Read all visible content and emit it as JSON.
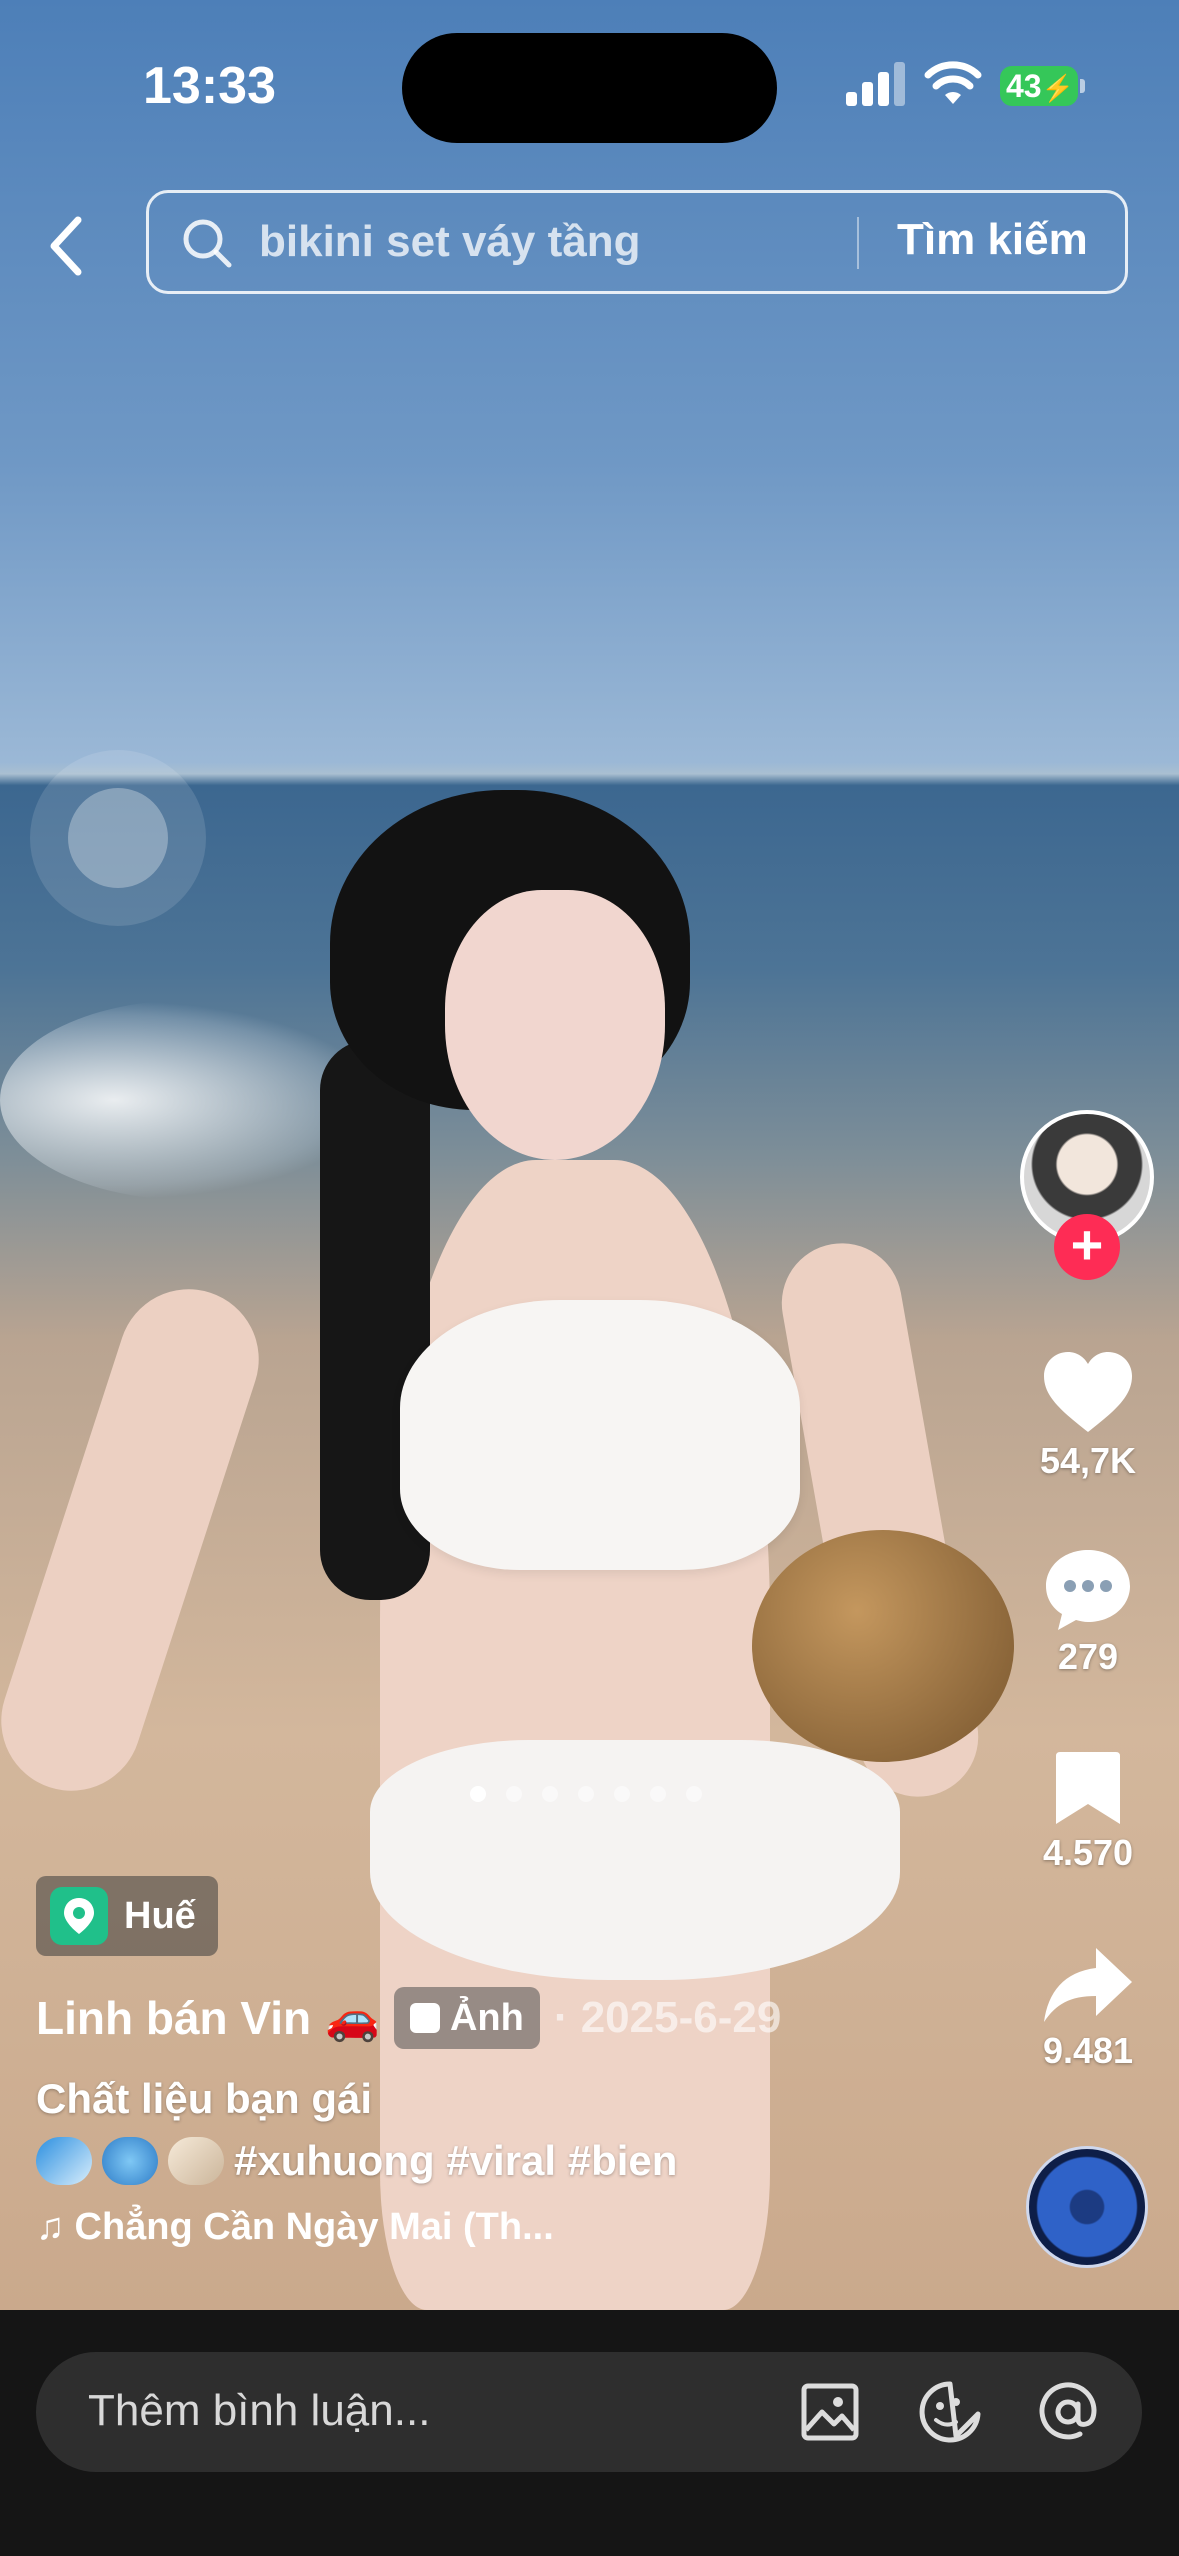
{
  "status_bar": {
    "time": "13:33",
    "battery": "43"
  },
  "search": {
    "query": "bikini set váy tầng",
    "button_label": "Tìm kiếm"
  },
  "rail": {
    "likes": "54,7K",
    "comments": "279",
    "saves": "4.570",
    "shares": "9.481",
    "follow_symbol": "+"
  },
  "carousel": {
    "total": 7,
    "active_index": 0
  },
  "post": {
    "location": "Huế",
    "author": "Linh bán Vin",
    "author_emoji": "🚗",
    "type_tag": "Ảnh",
    "date": "· 2025-6-29",
    "caption_line1": "Chất liệu bạn gái",
    "hashtags": "#xuhuong #viral #bien",
    "sound": "Chẳng Cần Ngày Mai (Th..."
  },
  "comment_bar": {
    "placeholder": "Thêm bình luận..."
  },
  "colors": {
    "follow_red": "#fe2c55",
    "location_green": "#20c08a",
    "battery_green": "#35c759"
  }
}
